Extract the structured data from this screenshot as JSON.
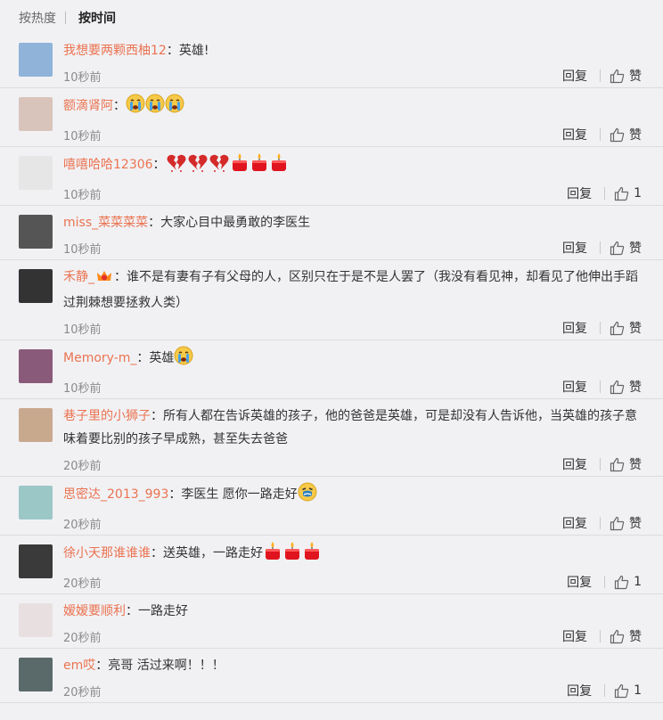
{
  "tabs": [
    {
      "label": "按热度",
      "active": false
    },
    {
      "label": "按时间",
      "active": true
    }
  ],
  "labels": {
    "reply": "回复",
    "like": "赞"
  },
  "colors": {
    "username": "#eb7350",
    "background": "#f1f1f4"
  },
  "comments": [
    {
      "user": "我想要两颗西柚12",
      "text": "英雄!",
      "time": "10秒前",
      "like": "赞",
      "emojis": [],
      "avatar_color": "#8fb3d9"
    },
    {
      "user": "额滴肾阿",
      "text": "",
      "time": "10秒前",
      "like": "赞",
      "emojis": [
        "crying-face-icon",
        "crying-face-icon",
        "crying-face-icon"
      ],
      "avatar_color": "#d9c4bb"
    },
    {
      "user": "嘻嘻哈哈12306",
      "text": "",
      "time": "10秒前",
      "like": "1",
      "emojis": [
        "broken-heart-icon",
        "broken-heart-icon",
        "broken-heart-icon",
        "candle-icon",
        "candle-icon",
        "candle-icon"
      ],
      "avatar_color": "#e6e6e6"
    },
    {
      "user": "miss_菜菜菜菜",
      "text": "大家心目中最勇敢的李医生",
      "time": "10秒前",
      "like": "赞",
      "emojis": [],
      "avatar_color": "#555555"
    },
    {
      "user": "禾静_",
      "text": "谁不是有妻有子有父母的人，区别只在于是不是人罢了（我没有看见神，却看见了他伸出手蹈过荆棘想要拯救人类）",
      "time": "10秒前",
      "like": "赞",
      "emojis": [],
      "vip": true,
      "avatar_color": "#333333"
    },
    {
      "user": "Memory-m_",
      "text": "英雄",
      "time": "10秒前",
      "like": "赞",
      "emojis": [
        "crying-face-icon"
      ],
      "avatar_color": "#8a5a7a"
    },
    {
      "user": "巷子里的小狮子",
      "text": "所有人都在告诉英雄的孩子，他的爸爸是英雄，可是却没有人告诉他，当英雄的孩子意味着要比别的孩子早成熟，甚至失去爸爸",
      "time": "20秒前",
      "like": "赞",
      "emojis": [],
      "avatar_color": "#c9a98e"
    },
    {
      "user": "思密达_2013_993",
      "text": "李医生 愿你一路走好",
      "time": "20秒前",
      "like": "赞",
      "emojis": [
        "sobbing-face-icon"
      ],
      "avatar_color": "#9cc7c7"
    },
    {
      "user": "徐小天那谁谁谁",
      "text": "送英雄，一路走好",
      "time": "20秒前",
      "like": "1",
      "emojis": [
        "candle-icon",
        "candle-icon",
        "candle-icon"
      ],
      "avatar_color": "#3a3a3a"
    },
    {
      "user": "嫒嫒要顺利",
      "text": "一路走好",
      "time": "20秒前",
      "like": "赞",
      "emojis": [],
      "avatar_color": "#e8e0e0"
    },
    {
      "user": "em哎",
      "text": "亮哥 活过来啊！！！",
      "time": "20秒前",
      "like": "1",
      "emojis": [],
      "avatar_color": "#5a6a6a"
    }
  ]
}
